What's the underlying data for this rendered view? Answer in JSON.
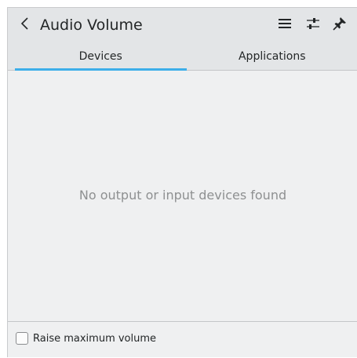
{
  "header": {
    "title": "Audio Volume",
    "back_icon": "chevron-left-icon",
    "menu_icon": "hamburger-menu-icon",
    "settings_icon": "sliders-icon",
    "pin_icon": "pin-icon"
  },
  "tabs": [
    {
      "label": "Devices",
      "active": true
    },
    {
      "label": "Applications",
      "active": false
    }
  ],
  "main": {
    "empty_message": "No output or input devices found"
  },
  "footer": {
    "raise_max_volume_label": "Raise maximum volume",
    "raise_max_volume_checked": false
  },
  "colors": {
    "accent": "#3daee9",
    "background": "#eff0f1",
    "header_background": "#e3e5e7",
    "text": "#232627",
    "muted_text": "#8e9091"
  }
}
